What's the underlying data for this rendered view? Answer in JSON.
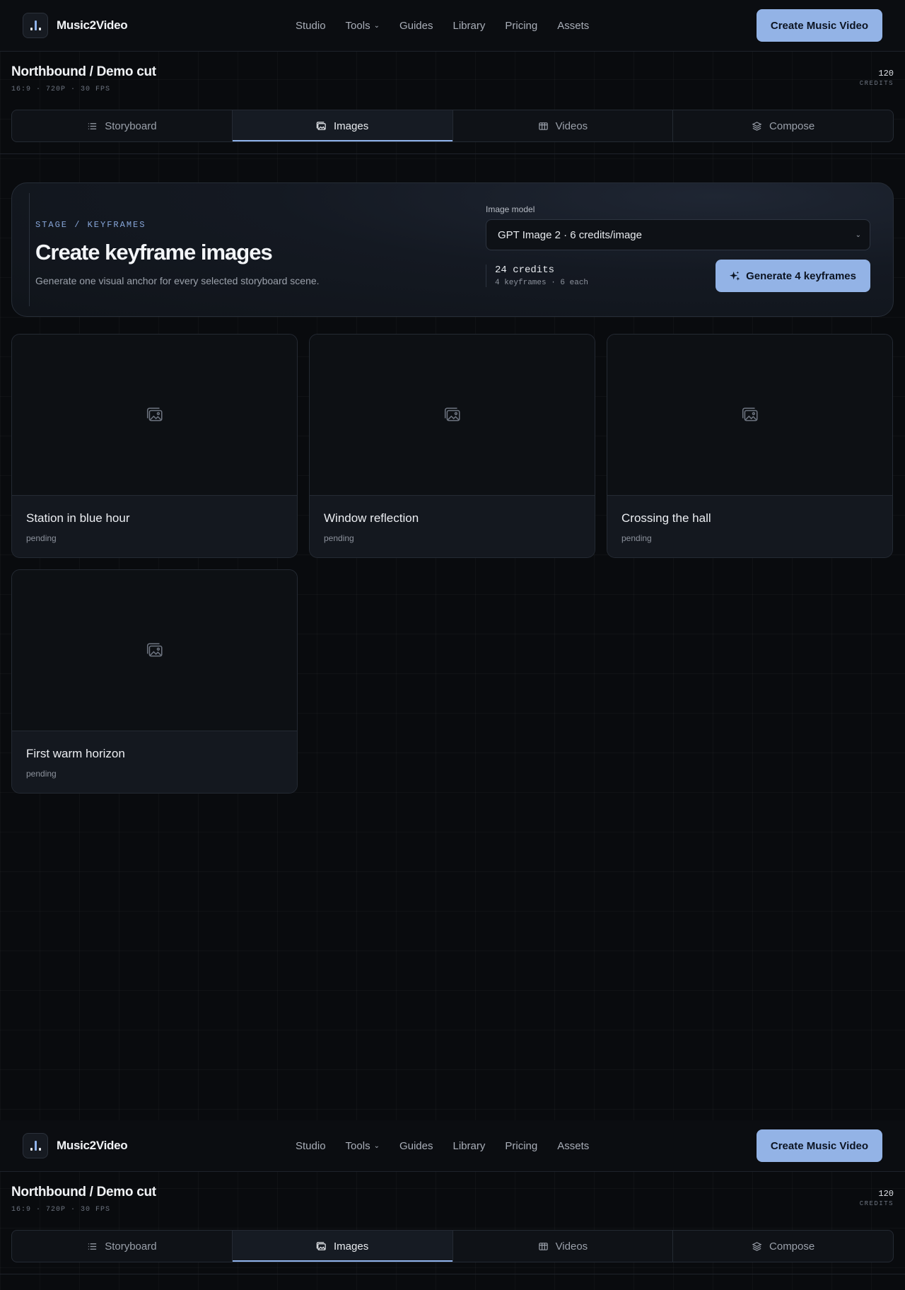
{
  "navbar": {
    "brand_name": "Music2Video",
    "links": [
      {
        "label": "Studio"
      },
      {
        "label": "Tools",
        "has_dropdown": true
      },
      {
        "label": "Guides"
      },
      {
        "label": "Library"
      },
      {
        "label": "Pricing"
      },
      {
        "label": "Assets"
      }
    ],
    "cta_label": "Create Music Video"
  },
  "project": {
    "title": "Northbound / Demo cut",
    "meta": "16:9 · 720P · 30 FPS",
    "credits_value": "120",
    "credits_label": "CREDITS"
  },
  "tabs": [
    {
      "label": "Storyboard",
      "icon": "list-icon",
      "active": false
    },
    {
      "label": "Images",
      "icon": "images-icon",
      "active": true
    },
    {
      "label": "Videos",
      "icon": "film-icon",
      "active": false
    },
    {
      "label": "Compose",
      "icon": "layers-icon",
      "active": false
    }
  ],
  "stage": {
    "eyebrow": "STAGE / KEYFRAMES",
    "title": "Create keyframe images",
    "description": "Generate one visual anchor for every selected storyboard scene.",
    "model_label": "Image model",
    "model_value": "GPT Image 2 · 6 credits/image",
    "cost_main": "24 credits",
    "cost_sub": "4 keyframes · 6 each",
    "generate_label": "Generate 4 keyframes"
  },
  "keyframes": [
    {
      "title": "Station in blue hour",
      "status": "pending"
    },
    {
      "title": "Window reflection",
      "status": "pending"
    },
    {
      "title": "Crossing the hall",
      "status": "pending"
    },
    {
      "title": "First warm horizon",
      "status": "pending"
    }
  ],
  "colors": {
    "accent": "#93b3e6",
    "background": "#090b0e",
    "panel": "#10141a"
  }
}
